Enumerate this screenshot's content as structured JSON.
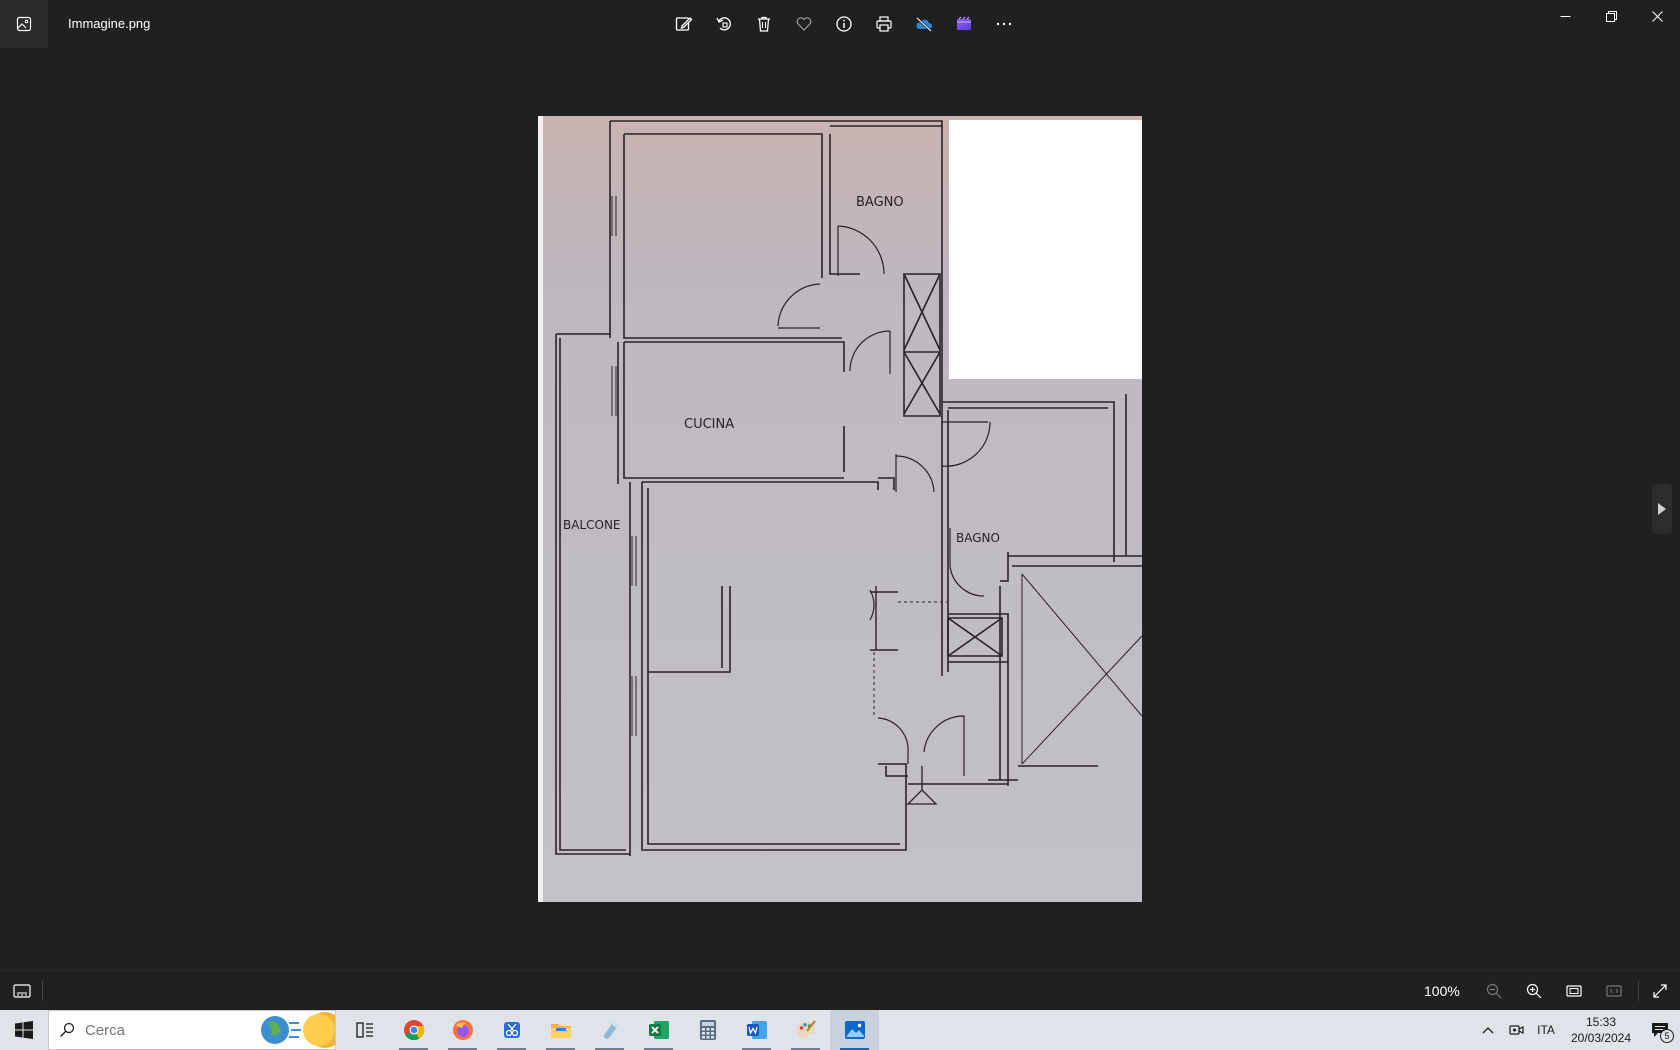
{
  "window": {
    "filename": "Immagine.png"
  },
  "toolbar": {
    "buttons": [
      "edit-image-icon",
      "rotate-icon",
      "delete-icon",
      "favorite-icon",
      "info-icon",
      "print-icon",
      "onedrive-icon",
      "clipchamp-icon",
      "more-icon"
    ]
  },
  "floorplan": {
    "rooms": {
      "bagno_top": "BAGNO",
      "cucina": "CUCINA",
      "balcone": "BALCONE",
      "bagno_right": "BAGNO"
    }
  },
  "bottombar": {
    "zoom": "100%"
  },
  "taskbar": {
    "search_placeholder": "Cerca",
    "language": "ITA",
    "time": "15:33",
    "date": "20/03/2024",
    "notification_count": "5",
    "apps": [
      "task-view-icon",
      "chrome-icon",
      "firefox-icon",
      "snipping-tool-icon",
      "file-explorer-icon",
      "paint-3d-icon",
      "excel-icon",
      "calculator-icon",
      "word-icon",
      "paint-icon",
      "photos-icon"
    ]
  },
  "colors": {
    "background": "#202020",
    "taskbar": "#dfe3ea",
    "accent": "#0078d4"
  }
}
